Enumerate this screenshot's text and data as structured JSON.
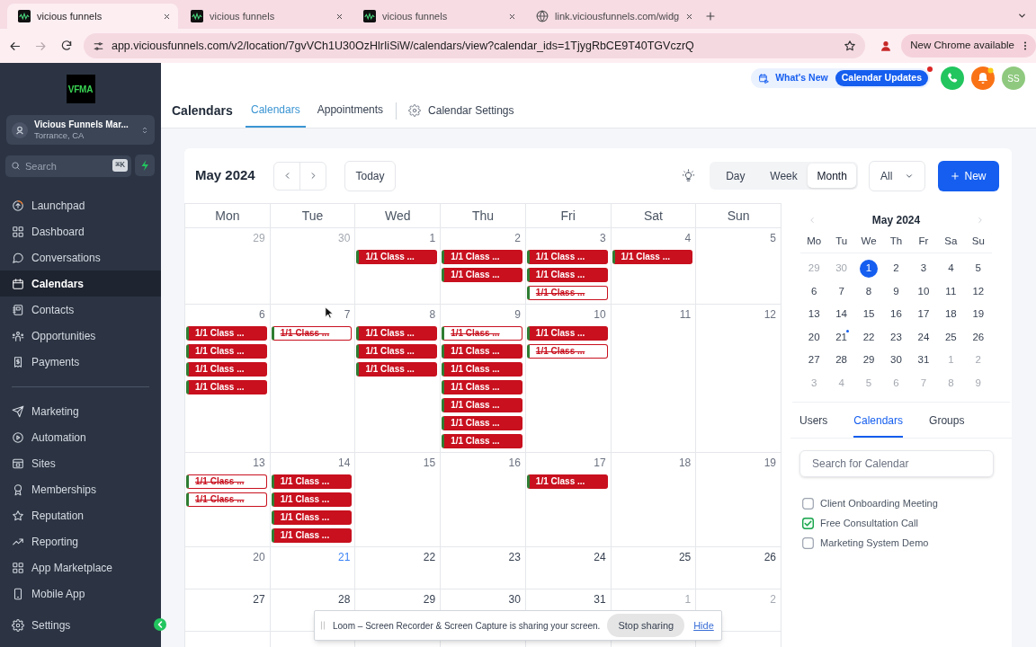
{
  "browser": {
    "tabs": [
      {
        "kind": "app",
        "title": "vicious funnels",
        "selected": true
      },
      {
        "kind": "app",
        "title": "vicious funnels",
        "selected": false
      },
      {
        "kind": "app",
        "title": "vicious funnels",
        "selected": false
      },
      {
        "kind": "web",
        "title": "link.viciousfunnels.com/widg",
        "selected": false
      }
    ],
    "url": "app.viciousfunnels.com/v2/location/7gvVCh1U30OzHlrIiSiW/calendars/view?calendar_ids=1TjygRbCE9T40TGVczrQ",
    "update_button": "New Chrome available"
  },
  "sidebar": {
    "logo": "VFMA",
    "account": {
      "name": "Vicious Funnels Mar...",
      "location": "Torrance, CA"
    },
    "search": {
      "placeholder": "Search",
      "shortcut": "⌘K"
    },
    "nav_sections": [
      {
        "items": [
          {
            "label": "Launchpad",
            "selected": false
          },
          {
            "label": "Dashboard",
            "selected": false
          },
          {
            "label": "Conversations",
            "selected": false
          },
          {
            "label": "Calendars",
            "selected": true
          },
          {
            "label": "Contacts",
            "selected": false
          },
          {
            "label": "Opportunities",
            "selected": false
          },
          {
            "label": "Payments",
            "selected": false
          }
        ]
      },
      {
        "items": [
          {
            "label": "Marketing",
            "selected": false
          },
          {
            "label": "Automation",
            "selected": false
          },
          {
            "label": "Sites",
            "selected": false
          },
          {
            "label": "Memberships",
            "selected": false
          },
          {
            "label": "Reputation",
            "selected": false
          },
          {
            "label": "Reporting",
            "selected": false
          },
          {
            "label": "App Marketplace",
            "selected": false
          },
          {
            "label": "Mobile App",
            "selected": false
          }
        ]
      }
    ],
    "settings": {
      "label": "Settings",
      "selected": false
    }
  },
  "header": {
    "whats_new": "What's New",
    "updates": "Calendar Updates",
    "avatar": "SS",
    "title": "Calendars",
    "tabs": [
      {
        "label": "Calendars",
        "selected": true
      },
      {
        "label": "Appointments",
        "selected": false
      }
    ],
    "settings": "Calendar Settings"
  },
  "calendar": {
    "title": "May 2024",
    "today_button": "Today",
    "views": [
      {
        "label": "Day",
        "selected": false
      },
      {
        "label": "Week",
        "selected": false
      },
      {
        "label": "Month",
        "selected": true
      }
    ],
    "filter": "All",
    "new_button": "New",
    "weekdays": [
      "Mon",
      "Tue",
      "Wed",
      "Thu",
      "Fri",
      "Sat",
      "Sun"
    ],
    "weeks": [
      {
        "days": [
          {
            "date": "29",
            "kind": "outside"
          },
          {
            "date": "30",
            "kind": "outside"
          },
          {
            "date": "1",
            "kind": "past",
            "events": [
              {
                "title": "1/1 Class ...",
                "cancelled": false
              }
            ]
          },
          {
            "date": "2",
            "kind": "past",
            "events": [
              {
                "title": "1/1 Class ...",
                "cancelled": false
              },
              {
                "title": "1/1 Class ...",
                "cancelled": false
              }
            ]
          },
          {
            "date": "3",
            "kind": "past",
            "events": [
              {
                "title": "1/1 Class ...",
                "cancelled": false
              },
              {
                "title": "1/1 Class ...",
                "cancelled": false
              },
              {
                "title": "1/1 Class ...",
                "cancelled": true
              }
            ]
          },
          {
            "date": "4",
            "kind": "past",
            "events": [
              {
                "title": "1/1 Class ...",
                "cancelled": false
              }
            ]
          },
          {
            "date": "5",
            "kind": "past"
          }
        ]
      },
      {
        "days": [
          {
            "date": "6",
            "kind": "past",
            "events": [
              {
                "title": "1/1 Class ...",
                "cancelled": false
              },
              {
                "title": "1/1 Class ...",
                "cancelled": false
              },
              {
                "title": "1/1 Class ...",
                "cancelled": false
              },
              {
                "title": "1/1 Class ...",
                "cancelled": false
              }
            ]
          },
          {
            "date": "7",
            "kind": "past",
            "events": [
              {
                "title": "1/1 Class ...",
                "cancelled": true
              }
            ]
          },
          {
            "date": "8",
            "kind": "past",
            "events": [
              {
                "title": "1/1 Class ...",
                "cancelled": false
              },
              {
                "title": "1/1 Class ...",
                "cancelled": false
              },
              {
                "title": "1/1 Class ...",
                "cancelled": false
              }
            ]
          },
          {
            "date": "9",
            "kind": "past",
            "events": [
              {
                "title": "1/1 Class ...",
                "cancelled": true
              },
              {
                "title": "1/1 Class ...",
                "cancelled": false
              },
              {
                "title": "1/1 Class ...",
                "cancelled": false
              },
              {
                "title": "1/1 Class ...",
                "cancelled": false
              },
              {
                "title": "1/1 Class ...",
                "cancelled": false
              },
              {
                "title": "1/1 Class ...",
                "cancelled": false
              },
              {
                "title": "1/1 Class ...",
                "cancelled": false
              }
            ]
          },
          {
            "date": "10",
            "kind": "past",
            "events": [
              {
                "title": "1/1 Class ...",
                "cancelled": false
              },
              {
                "title": "1/1 Class ...",
                "cancelled": true
              }
            ]
          },
          {
            "date": "11",
            "kind": "past"
          },
          {
            "date": "12",
            "kind": "past"
          }
        ]
      },
      {
        "days": [
          {
            "date": "13",
            "kind": "past",
            "events": [
              {
                "title": "1/1 Class ...",
                "cancelled": true
              },
              {
                "title": "1/1 Class ...",
                "cancelled": true
              }
            ]
          },
          {
            "date": "14",
            "kind": "past",
            "events": [
              {
                "title": "1/1 Class ...",
                "cancelled": false
              },
              {
                "title": "1/1 Class ...",
                "cancelled": false
              },
              {
                "title": "1/1 Class ...",
                "cancelled": false
              },
              {
                "title": "1/1 Class ...",
                "cancelled": false
              }
            ]
          },
          {
            "date": "15",
            "kind": "past"
          },
          {
            "date": "16",
            "kind": "past"
          },
          {
            "date": "17",
            "kind": "past",
            "events": [
              {
                "title": "1/1 Class ...",
                "cancelled": false
              }
            ]
          },
          {
            "date": "18",
            "kind": "past"
          },
          {
            "date": "19",
            "kind": "past"
          }
        ]
      },
      {
        "days": [
          {
            "date": "20",
            "kind": "past"
          },
          {
            "date": "21",
            "kind": "today"
          },
          {
            "date": "22",
            "kind": "upcoming"
          },
          {
            "date": "23",
            "kind": "upcoming"
          },
          {
            "date": "24",
            "kind": "upcoming"
          },
          {
            "date": "25",
            "kind": "upcoming"
          },
          {
            "date": "26",
            "kind": "upcoming"
          }
        ]
      },
      {
        "days": [
          {
            "date": "27",
            "kind": "upcoming"
          },
          {
            "date": "28",
            "kind": "upcoming"
          },
          {
            "date": "29",
            "kind": "upcoming"
          },
          {
            "date": "30",
            "kind": "upcoming"
          },
          {
            "date": "31",
            "kind": "upcoming"
          },
          {
            "date": "1",
            "kind": "outside"
          },
          {
            "date": "2",
            "kind": "outside"
          }
        ]
      }
    ]
  },
  "side_panel": {
    "month": "May 2024",
    "weekdays": [
      "Mo",
      "Tu",
      "We",
      "Th",
      "Fr",
      "Sa",
      "Su"
    ],
    "weeks": [
      {
        "days": [
          {
            "date": "29",
            "kind": "outside",
            "selected": false
          },
          {
            "date": "30",
            "kind": "outside",
            "selected": false
          },
          {
            "date": "1",
            "kind": "current",
            "selected": true
          },
          {
            "date": "2",
            "kind": "current",
            "selected": false
          },
          {
            "date": "3",
            "kind": "current",
            "selected": false
          },
          {
            "date": "4",
            "kind": "current",
            "selected": false
          },
          {
            "date": "5",
            "kind": "current",
            "selected": false
          }
        ]
      },
      {
        "days": [
          {
            "date": "6",
            "kind": "current",
            "selected": false
          },
          {
            "date": "7",
            "kind": "current",
            "selected": false
          },
          {
            "date": "8",
            "kind": "current",
            "selected": false
          },
          {
            "date": "9",
            "kind": "current",
            "selected": false
          },
          {
            "date": "10",
            "kind": "current",
            "selected": false
          },
          {
            "date": "11",
            "kind": "current",
            "selected": false
          },
          {
            "date": "12",
            "kind": "current",
            "selected": false
          }
        ]
      },
      {
        "days": [
          {
            "date": "13",
            "kind": "current",
            "selected": false
          },
          {
            "date": "14",
            "kind": "current",
            "selected": false
          },
          {
            "date": "15",
            "kind": "current",
            "selected": false
          },
          {
            "date": "16",
            "kind": "current",
            "selected": false
          },
          {
            "date": "17",
            "kind": "current",
            "selected": false
          },
          {
            "date": "18",
            "kind": "current",
            "selected": false
          },
          {
            "date": "19",
            "kind": "current",
            "selected": false
          }
        ]
      },
      {
        "days": [
          {
            "date": "20",
            "kind": "current",
            "selected": false
          },
          {
            "date": "21",
            "kind": "today",
            "selected": false
          },
          {
            "date": "22",
            "kind": "current",
            "selected": false
          },
          {
            "date": "23",
            "kind": "current",
            "selected": false
          },
          {
            "date": "24",
            "kind": "current",
            "selected": false
          },
          {
            "date": "25",
            "kind": "current",
            "selected": false
          },
          {
            "date": "26",
            "kind": "current",
            "selected": false
          }
        ]
      },
      {
        "days": [
          {
            "date": "27",
            "kind": "current",
            "selected": false
          },
          {
            "date": "28",
            "kind": "current",
            "selected": false
          },
          {
            "date": "29",
            "kind": "current",
            "selected": false
          },
          {
            "date": "30",
            "kind": "current",
            "selected": false
          },
          {
            "date": "31",
            "kind": "current",
            "selected": false
          },
          {
            "date": "1",
            "kind": "outside",
            "selected": false
          },
          {
            "date": "2",
            "kind": "outside",
            "selected": false
          }
        ]
      },
      {
        "days": [
          {
            "date": "3",
            "kind": "outside",
            "selected": false
          },
          {
            "date": "4",
            "kind": "outside",
            "selected": false
          },
          {
            "date": "5",
            "kind": "outside",
            "selected": false
          },
          {
            "date": "6",
            "kind": "outside",
            "selected": false
          },
          {
            "date": "7",
            "kind": "outside",
            "selected": false
          },
          {
            "date": "8",
            "kind": "outside",
            "selected": false
          },
          {
            "date": "9",
            "kind": "outside",
            "selected": false
          }
        ]
      }
    ],
    "tabs": [
      {
        "label": "Users",
        "selected": false
      },
      {
        "label": "Calendars",
        "selected": true
      },
      {
        "label": "Groups",
        "selected": false
      }
    ],
    "search": {
      "placeholder": "Search for Calendar"
    },
    "calendars": [
      {
        "label": "Client Onboarding Meeting",
        "checked": false
      },
      {
        "label": "Free Consultation Call",
        "checked": true
      },
      {
        "label": "Marketing System Demo",
        "checked": false
      }
    ]
  },
  "screen_share_bar": {
    "message": "Loom – Screen Recorder & Screen Capture is sharing your screen.",
    "stop_button": "Stop sharing",
    "hide_link": "Hide"
  }
}
